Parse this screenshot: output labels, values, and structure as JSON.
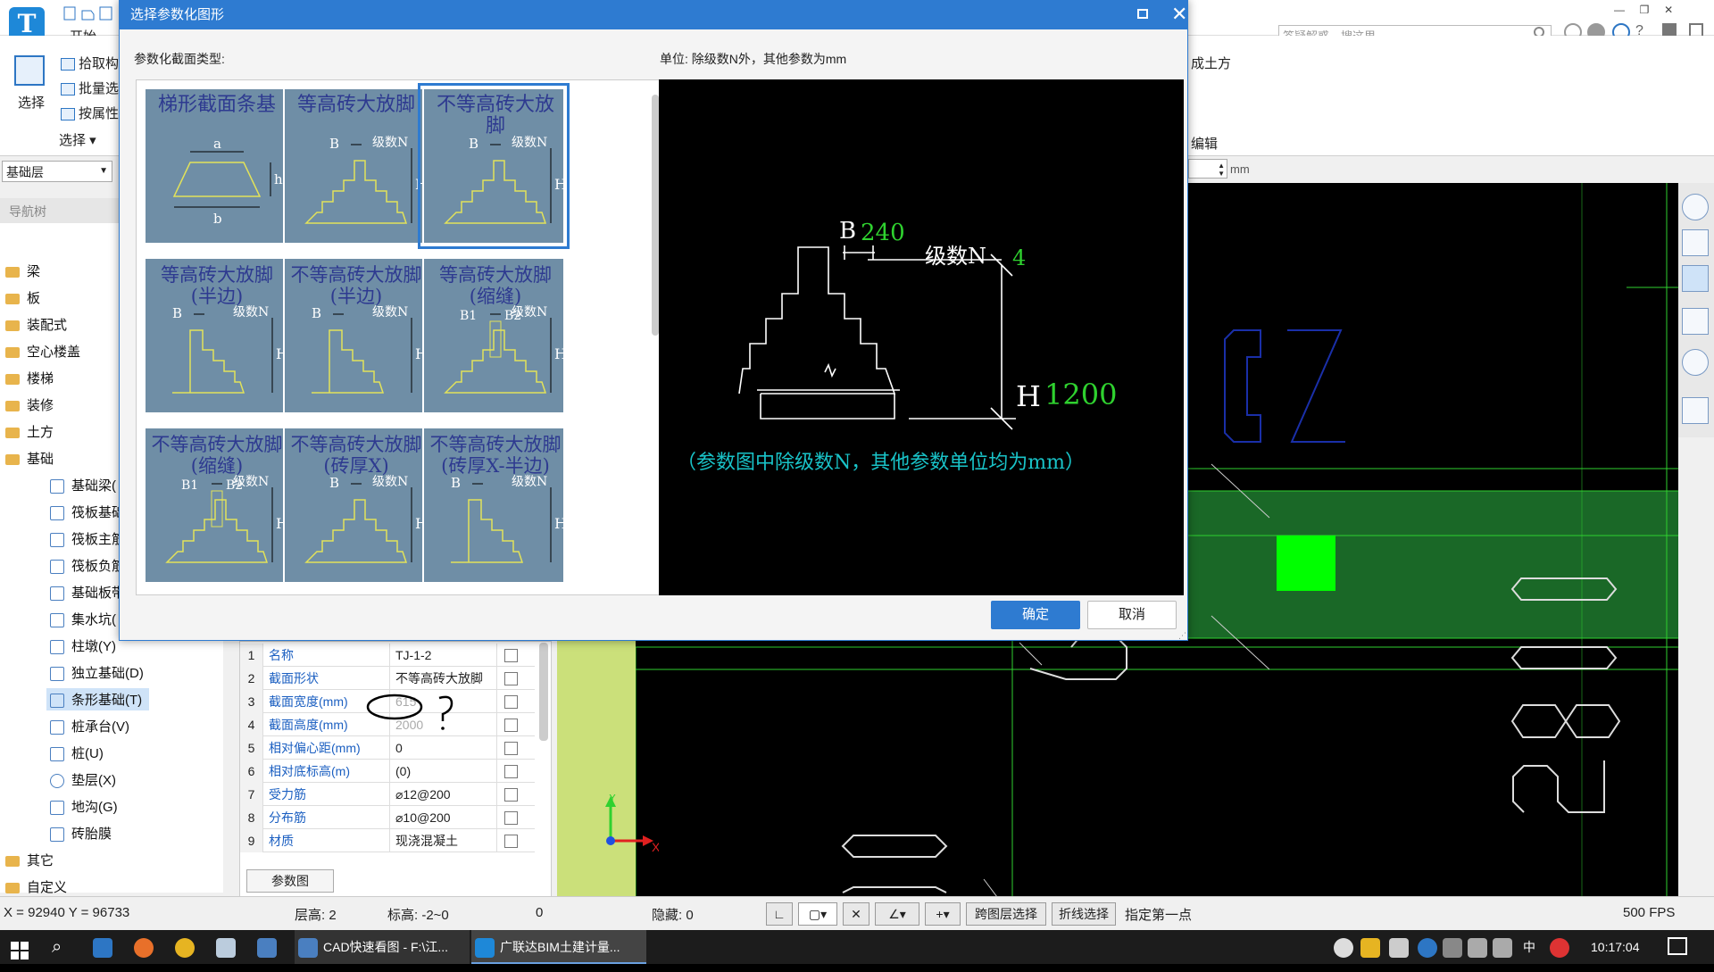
{
  "app": {
    "tab_start": "开始",
    "search_placeholder": "答疑解惑，搜这里",
    "ribbon": {
      "select": "选择",
      "pick": "拾取构",
      "batch": "批量选",
      "by_attr": "按属性",
      "select_menu": "选择 ▾",
      "earthwork": "成土方",
      "edit": "编辑"
    }
  },
  "left": {
    "floor": "基础层",
    "nav_title": "导航树",
    "tree": [
      "梁",
      "板",
      "装配式",
      "空心楼盖",
      "楼梯",
      "装修",
      "土方",
      "基础"
    ],
    "sub": [
      "基础梁(",
      "筏板基础",
      "筏板主筋",
      "筏板负筋",
      "基础板带",
      "集水坑(",
      "柱墩(Y)",
      "独立基础(D)",
      "条形基础(T)",
      "桩承台(V)",
      "桩(U)",
      "垫层(X)",
      "地沟(G)",
      "砖胎膜"
    ],
    "tree2": [
      "其它",
      "自定义"
    ]
  },
  "props": {
    "rows": [
      {
        "n": "1",
        "name": "名称",
        "val": "TJ-1-2",
        "chk": false
      },
      {
        "n": "2",
        "name": "截面形状",
        "val": "不等高砖大放脚",
        "chk": true
      },
      {
        "n": "3",
        "name": "截面宽度(mm)",
        "val": "615",
        "chk": true,
        "gray": true
      },
      {
        "n": "4",
        "name": "截面高度(mm)",
        "val": "2000",
        "chk": true,
        "gray": true
      },
      {
        "n": "5",
        "name": "相对偏心距(mm)",
        "val": "0",
        "chk": true
      },
      {
        "n": "6",
        "name": "相对底标高(m)",
        "val": "(0)",
        "chk": true
      },
      {
        "n": "7",
        "name": "受力筋",
        "val": "⌀12@200",
        "chk": true
      },
      {
        "n": "8",
        "name": "分布筋",
        "val": "⌀10@200",
        "chk": true
      },
      {
        "n": "9",
        "name": "材质",
        "val": "现浇混凝土",
        "chk": true
      }
    ],
    "param_btn": "参数图",
    "annotation": "?"
  },
  "dialog": {
    "title": "选择参数化图形",
    "type_label": "参数化截面类型:",
    "unit_label": "单位:  除级数N外，其他参数为mm",
    "thumbs": [
      {
        "t": "梯形截面条基",
        "kind": "trap"
      },
      {
        "t": "等高砖大放脚",
        "kind": "full"
      },
      {
        "t": "不等高砖大放脚",
        "kind": "full",
        "sel": true
      },
      {
        "t": "等高砖大放脚(半边)",
        "kind": "half"
      },
      {
        "t": "不等高砖大放脚(半边)",
        "kind": "half"
      },
      {
        "t": "等高砖大放脚(缩缝)",
        "kind": "gap"
      },
      {
        "t": "不等高砖大放脚(缩缝)",
        "kind": "gap"
      },
      {
        "t": "不等高砖大放脚(砖厚X)",
        "kind": "full"
      },
      {
        "t": "不等高砖大放脚(砖厚X-半边)",
        "kind": "half"
      }
    ],
    "thumb_labels": {
      "a": "a",
      "b": "b",
      "h": "h",
      "B": "B",
      "H": "H",
      "N": "级数N",
      "B1": "B1",
      "B2": "B2"
    },
    "preview": {
      "B_label": "B",
      "B_val": "240",
      "N_label": "级数N",
      "N_val": "4",
      "H_label": "H",
      "H_val": "1200",
      "note": "（参数图中除级数N，其他参数单位均为mm）"
    },
    "ok": "确定",
    "cancel": "取消"
  },
  "cad": {
    "mm": "mm"
  },
  "status": {
    "coords": "X = 92940 Y = 96733",
    "floor_h": "层高:  2",
    "elev": "标高:  -2~0",
    "zero": "0",
    "hidden": "隐藏:  0",
    "cross_floor": "跨图层选择",
    "polyline": "折线选择",
    "prompt": "指定第一点",
    "fps": "500 FPS"
  },
  "taskbar": {
    "cad": "CAD快速看图 - F:\\江...",
    "gld": "广联达BIM土建计量...",
    "ime": "中",
    "time": "10:17:04"
  },
  "colors": {
    "accent": "#2e7bd1",
    "thumb_bg": "#6f8ea6",
    "preview_green": "#2fd12f",
    "preview_cyan": "#19c3c8"
  }
}
